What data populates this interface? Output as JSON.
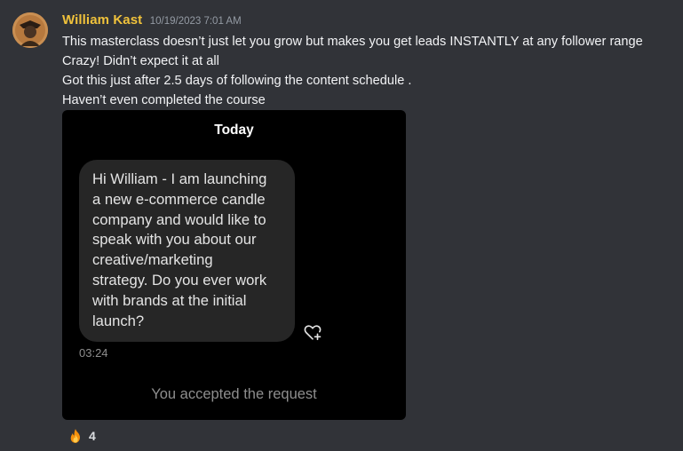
{
  "message": {
    "author": "William Kast",
    "timestamp": "10/19/2023 7:01 AM",
    "author_color": "#f0c23b",
    "avatar_icon": "user-avatar",
    "lines": [
      "This masterclass doesn’t just let you grow but makes you get leads INSTANTLY at any follower range",
      "Crazy! Didn’t expect it at all",
      "Got this just after 2.5 days of following the content schedule .",
      "Haven’t even completed the course"
    ]
  },
  "attachment": {
    "day_label": "Today",
    "bubble_text": "Hi William - I am launching\na new e-commerce candle\ncompany and would like to\nspeak with you  about our\ncreative/marketing\nstrategy. Do you ever work\nwith brands at the initial\nlaunch?",
    "heart_icon": "heart-plus-icon",
    "time": "03:24",
    "status_text": "You accepted the request"
  },
  "reaction": {
    "icon": "fire-icon",
    "count": "4"
  }
}
